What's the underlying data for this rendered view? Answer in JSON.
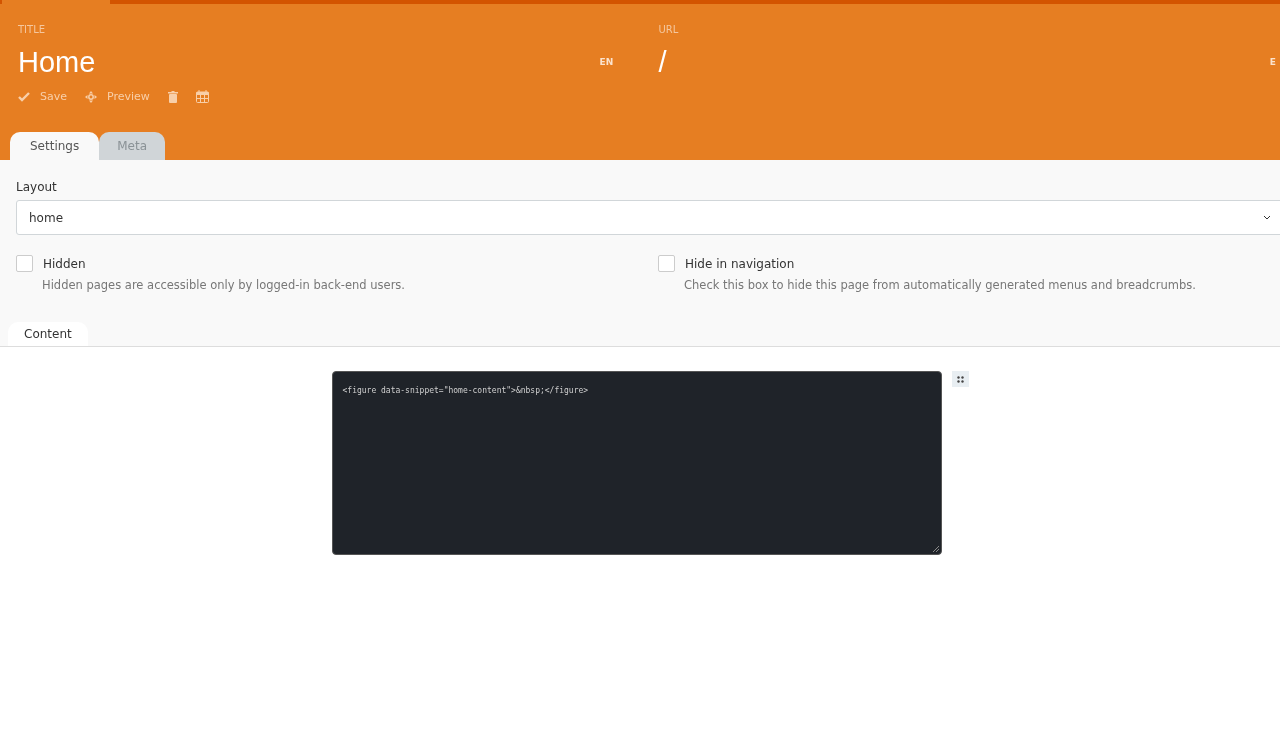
{
  "title_field": {
    "label": "TITLE",
    "value": "Home",
    "locale": "EN"
  },
  "url_field": {
    "label": "URL",
    "value": "/",
    "locale": "E"
  },
  "toolbar": [
    {
      "kind": "save",
      "label": "Save"
    },
    {
      "kind": "preview",
      "label": "Preview"
    },
    {
      "kind": "delete"
    },
    {
      "kind": "calendar"
    }
  ],
  "tabs": [
    {
      "label": "Settings",
      "selected": true
    },
    {
      "label": "Meta",
      "selected": false
    }
  ],
  "layout": {
    "label": "Layout",
    "value": "home"
  },
  "checkboxes": [
    {
      "label": "Hidden",
      "help": "Hidden pages are accessible only by logged-in back-end users.",
      "checked": false
    },
    {
      "label": "Hide in navigation",
      "help": "Check this box to hide this page from automatically generated menus and breadcrumbs.",
      "checked": false
    }
  ],
  "content_tabs": [
    {
      "label": "Content",
      "selected": true
    }
  ],
  "editor": {
    "code": "<figure data-snippet=\"home-content\">&nbsp;</figure>"
  }
}
